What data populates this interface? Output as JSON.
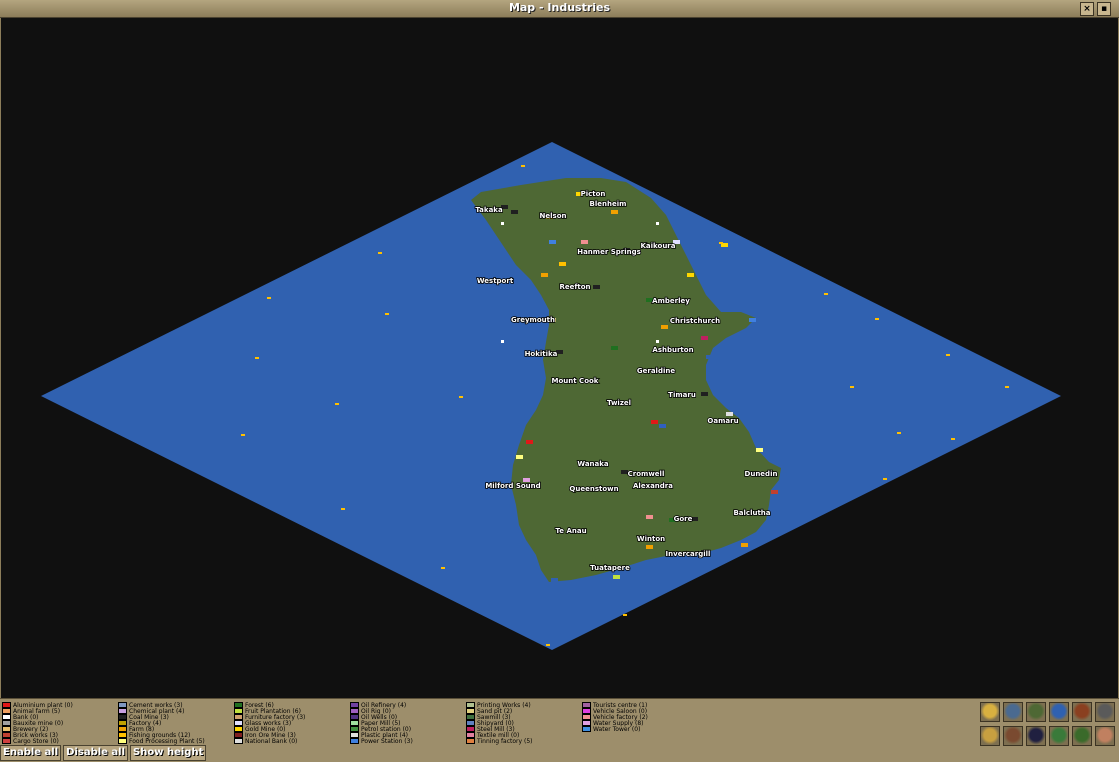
{
  "window": {
    "title": "Map - Industries",
    "pin_glyph": "×",
    "fold_glyph": "▪"
  },
  "colors": {
    "water": "#3061b0",
    "land": "#4e6834",
    "window_bg": "#9d8e6b",
    "title_bg": "#a0916d"
  },
  "towns": [
    {
      "name": "Picton"
    },
    {
      "name": "Blenheim"
    },
    {
      "name": "Takaka"
    },
    {
      "name": "Nelson"
    },
    {
      "name": "Kaikoura"
    },
    {
      "name": "Hanmer Springs"
    },
    {
      "name": "Westport"
    },
    {
      "name": "Reefton"
    },
    {
      "name": "Amberley"
    },
    {
      "name": "Greymouth"
    },
    {
      "name": "Christchurch"
    },
    {
      "name": "Hokitika"
    },
    {
      "name": "Ashburton"
    },
    {
      "name": "Geraldine"
    },
    {
      "name": "Mount Cook"
    },
    {
      "name": "Timaru"
    },
    {
      "name": "Twizel"
    },
    {
      "name": "Oamaru"
    },
    {
      "name": "Wanaka"
    },
    {
      "name": "Cromwell"
    },
    {
      "name": "Dunedin"
    },
    {
      "name": "Milford Sound"
    },
    {
      "name": "Queenstown"
    },
    {
      "name": "Alexandra"
    },
    {
      "name": "Balclutha"
    },
    {
      "name": "Gore"
    },
    {
      "name": "Te Anau"
    },
    {
      "name": "Winton"
    },
    {
      "name": "Invercargill"
    },
    {
      "name": "Tuatapere"
    }
  ],
  "legend": {
    "columns": [
      [
        {
          "label": "Aluminium plant (0)",
          "color": "#e01818"
        },
        {
          "label": "Animal farm (5)",
          "color": "#f0a060"
        },
        {
          "label": "Bank (0)",
          "color": "#ffffff"
        },
        {
          "label": "Bauxite mine (0)",
          "color": "#a0a0a0"
        },
        {
          "label": "Brewery (2)",
          "color": "#e8c070"
        },
        {
          "label": "Brick works (3)",
          "color": "#c04030"
        },
        {
          "label": "Cargo Store (0)",
          "color": "#d04040"
        }
      ],
      [
        {
          "label": "Cement works (3)",
          "color": "#8098c0"
        },
        {
          "label": "Chemical plant (4)",
          "color": "#c8a0e0"
        },
        {
          "label": "Coal Mine (3)",
          "color": "#202020"
        },
        {
          "label": "Factory (4)",
          "color": "#c0a000"
        },
        {
          "label": "Farm (8)",
          "color": "#f0a000"
        },
        {
          "label": "Fishing grounds (12)",
          "color": "#ffc000"
        },
        {
          "label": "Food Processing Plant (5)",
          "color": "#ffff80"
        }
      ],
      [
        {
          "label": "Forest (6)",
          "color": "#207020"
        },
        {
          "label": "Fruit Plantation (6)",
          "color": "#c0e040"
        },
        {
          "label": "Furniture factory (3)",
          "color": "#d0a070"
        },
        {
          "label": "Glass works (3)",
          "color": "#e0e0ff"
        },
        {
          "label": "Gold Mine (0)",
          "color": "#ffd700"
        },
        {
          "label": "Iron Ore Mine (3)",
          "color": "#802020"
        },
        {
          "label": "National Bank (0)",
          "color": "#e0e0e0"
        }
      ],
      [
        {
          "label": "Oil Refinery (4)",
          "color": "#7040a0"
        },
        {
          "label": "Oil Rig (0)",
          "color": "#a060c0"
        },
        {
          "label": "Oil Wells (0)",
          "color": "#503080"
        },
        {
          "label": "Paper Mill (5)",
          "color": "#a0e0a0"
        },
        {
          "label": "Petrol station (0)",
          "color": "#409040"
        },
        {
          "label": "Plastic plant (4)",
          "color": "#e0e0e0"
        },
        {
          "label": "Power Station (3)",
          "color": "#4080e0"
        }
      ],
      [
        {
          "label": "Printing Works (4)",
          "color": "#b0c090"
        },
        {
          "label": "Sand pit (2)",
          "color": "#e0d080"
        },
        {
          "label": "Sawmill (3)",
          "color": "#407040"
        },
        {
          "label": "Shipyard (0)",
          "color": "#6080c0"
        },
        {
          "label": "Steel Mill (3)",
          "color": "#c02060"
        },
        {
          "label": "Textile mill (0)",
          "color": "#e080a0"
        },
        {
          "label": "Tinning factory (5)",
          "color": "#e08040"
        }
      ],
      [
        {
          "label": "Tourists centre (1)",
          "color": "#a060a0"
        },
        {
          "label": "Vehicle Saloon (0)",
          "color": "#e040e0"
        },
        {
          "label": "Vehicle factory (2)",
          "color": "#f09090"
        },
        {
          "label": "Water Supply (8)",
          "color": "#e0a0e0"
        },
        {
          "label": "Water Tower (0)",
          "color": "#4090e0"
        }
      ]
    ]
  },
  "buttons": {
    "enable_all": "Enable all",
    "disable_all": "Disable all",
    "show_height": "Show height"
  },
  "mode_icons": [
    {
      "icon": "contours-icon"
    },
    {
      "icon": "vehicles-icon"
    },
    {
      "icon": "industries-icon"
    },
    {
      "icon": "routes-icon"
    },
    {
      "icon": "vegetation-icon"
    },
    {
      "icon": "owners-icon"
    },
    {
      "icon": "center-view-icon"
    },
    {
      "icon": "toggle-town-names-icon"
    },
    {
      "icon": "link-industries-icon"
    },
    {
      "icon": "cargo-flow-icon"
    },
    {
      "icon": "trees-icon"
    },
    {
      "icon": "company-face-icon"
    }
  ]
}
